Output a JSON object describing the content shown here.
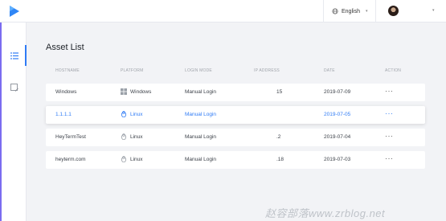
{
  "header": {
    "language": "English"
  },
  "page": {
    "title": "Asset List"
  },
  "table": {
    "columns": [
      "HOSTNAME",
      "PLATFORM",
      "LOGIN MODE",
      "IP ADDRESS",
      "DATE",
      "ACTION"
    ],
    "rows": [
      {
        "hostname": "Windows",
        "platform": "Windows",
        "login_mode": "Manual Login",
        "ip": "15",
        "date": "2019-07-09",
        "action": "···"
      },
      {
        "hostname": "1.1.1.1",
        "platform": "Linux",
        "login_mode": "Manual Login",
        "ip": "",
        "date": "2019-07-05",
        "action": "···"
      },
      {
        "hostname": "HeyTermTest",
        "platform": "Linux",
        "login_mode": "Manual Login",
        "ip": ".2",
        "date": "2019-07-04",
        "action": "···"
      },
      {
        "hostname": "heyterm.com",
        "platform": "Linux",
        "login_mode": "Manual Login",
        "ip": ".18",
        "date": "2019-07-03",
        "action": "···"
      }
    ]
  },
  "watermark": "赵容部落www.zrblog.net",
  "colors": {
    "accent": "#2f7bf5",
    "sidebar_accent": "#7b6cf0",
    "background": "#f2f3f6"
  },
  "icons": {
    "logo": "play-triangle-logo",
    "language": "globe-icon",
    "nav_assets": "list-icon",
    "nav_other": "edit-note-icon",
    "windows": "windows-icon",
    "linux": "linux-icon"
  }
}
